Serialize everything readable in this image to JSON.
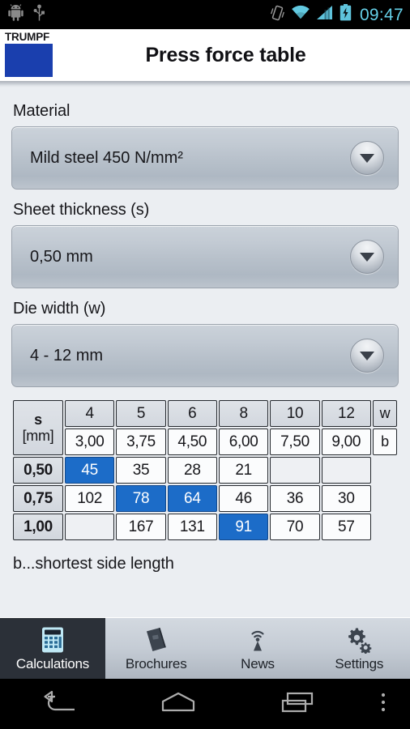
{
  "statusbar": {
    "left_icons": [
      "android-robot-icon",
      "usb-icon"
    ],
    "right_icons": [
      "vibrate-icon",
      "wifi-icon",
      "cellular-signal-icon",
      "battery-charging-icon"
    ],
    "clock": "09:47",
    "clock_color": "#65D0E8"
  },
  "titlebar": {
    "logo_text": "TRUMPF",
    "logo_color": "#1A3FAE",
    "title": "Press force table"
  },
  "form": {
    "material": {
      "label": "Material",
      "value": "Mild steel 450 N/mm²"
    },
    "sheet_thickness": {
      "label": "Sheet thickness (s)",
      "value": "0,50 mm"
    },
    "die_width": {
      "label": "Die width (w)",
      "value": "4 - 12 mm"
    }
  },
  "table": {
    "corner_symbol": "s",
    "corner_unit": "[mm]",
    "w_label": "w",
    "b_label": "b",
    "die_widths": [
      "4",
      "5",
      "6",
      "8",
      "10",
      "12"
    ],
    "b_values": [
      "3,00",
      "3,75",
      "4,50",
      "6,00",
      "7,50",
      "9,00"
    ],
    "rows": [
      {
        "thickness": "0,50",
        "cells": [
          "45",
          "35",
          "28",
          "21",
          "",
          ""
        ],
        "selected": [
          true,
          false,
          false,
          false,
          false,
          false
        ]
      },
      {
        "thickness": "0,75",
        "cells": [
          "102",
          "78",
          "64",
          "46",
          "36",
          "30"
        ],
        "selected": [
          false,
          true,
          true,
          false,
          false,
          false
        ]
      },
      {
        "thickness": "1,00",
        "cells": [
          "",
          "167",
          "131",
          "91",
          "70",
          "57"
        ],
        "selected": [
          false,
          false,
          false,
          true,
          false,
          false
        ]
      }
    ],
    "selected_color": "#1C6CC8"
  },
  "legend": "b...shortest side length",
  "tabbar": {
    "tabs": [
      {
        "label": "Calculations",
        "icon": "calculator-icon",
        "active": true
      },
      {
        "label": "Brochures",
        "icon": "book-icon",
        "active": false
      },
      {
        "label": "News",
        "icon": "broadcast-tower-icon",
        "active": false
      },
      {
        "label": "Settings",
        "icon": "gears-icon",
        "active": false
      }
    ]
  },
  "navbar": {
    "buttons": [
      "back-icon",
      "home-icon",
      "recents-icon",
      "overflow-menu-icon"
    ]
  }
}
